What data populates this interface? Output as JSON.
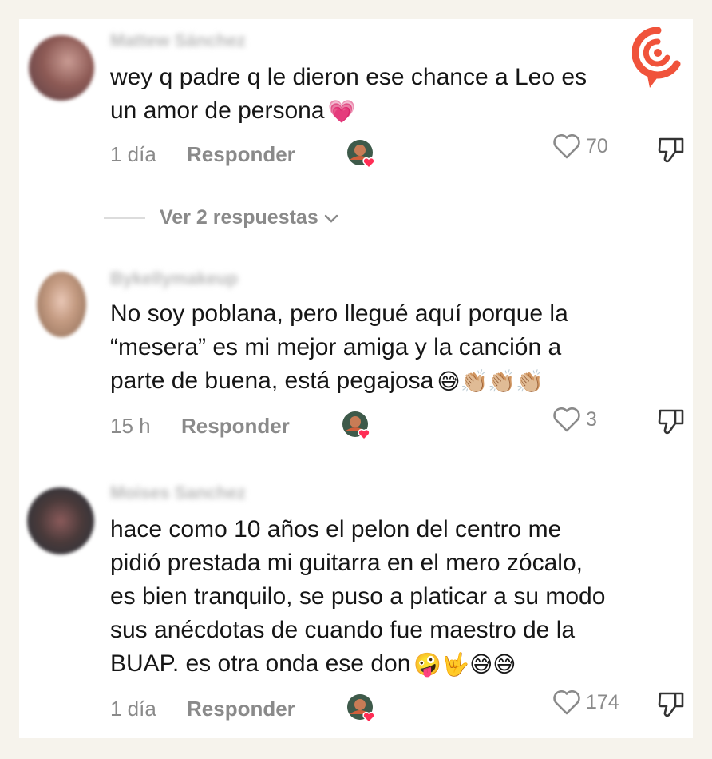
{
  "comments": [
    {
      "username": "Mattew Sánchez",
      "lines": [
        "wey q padre q le dieron ese chance a Leo es",
        "un amor de persona"
      ],
      "emoji_line1": "💗",
      "time": "1 día",
      "reply": "Responder",
      "likes": "70"
    },
    {
      "username": "Bykellymakeup",
      "lines": [
        "No soy poblana, pero llegué aquí porque la",
        "“mesera” es mi mejor amiga y la canción a",
        "parte de buena, está pegajosa"
      ],
      "emoji_line3": "😅👏🏼👏🏼👏🏼",
      "time": "15 h",
      "reply": "Responder",
      "likes": "3"
    },
    {
      "username": "Moises Sanchez",
      "lines": [
        "hace como 10 años el pelon del centro me",
        "pidió prestada mi guitarra en el mero zócalo,",
        "es bien tranquilo, se puso a platicar a su modo",
        "sus anécdotas de cuando fue maestro de la",
        "BUAP. es otra onda ese don"
      ],
      "emoji_line5": "🤪🤟😅😅",
      "time": "1 día",
      "reply": "Responder",
      "likes": "174"
    }
  ],
  "view_replies": "Ver 2 respuestas",
  "colors": {
    "heart_badge": "#ff2d55",
    "logo": "#f0533b"
  },
  "icons": [
    "heart-outline-icon",
    "dislike-icon",
    "chevron-down-icon",
    "creator-liked-badge-icon",
    "brand-logo-icon"
  ]
}
